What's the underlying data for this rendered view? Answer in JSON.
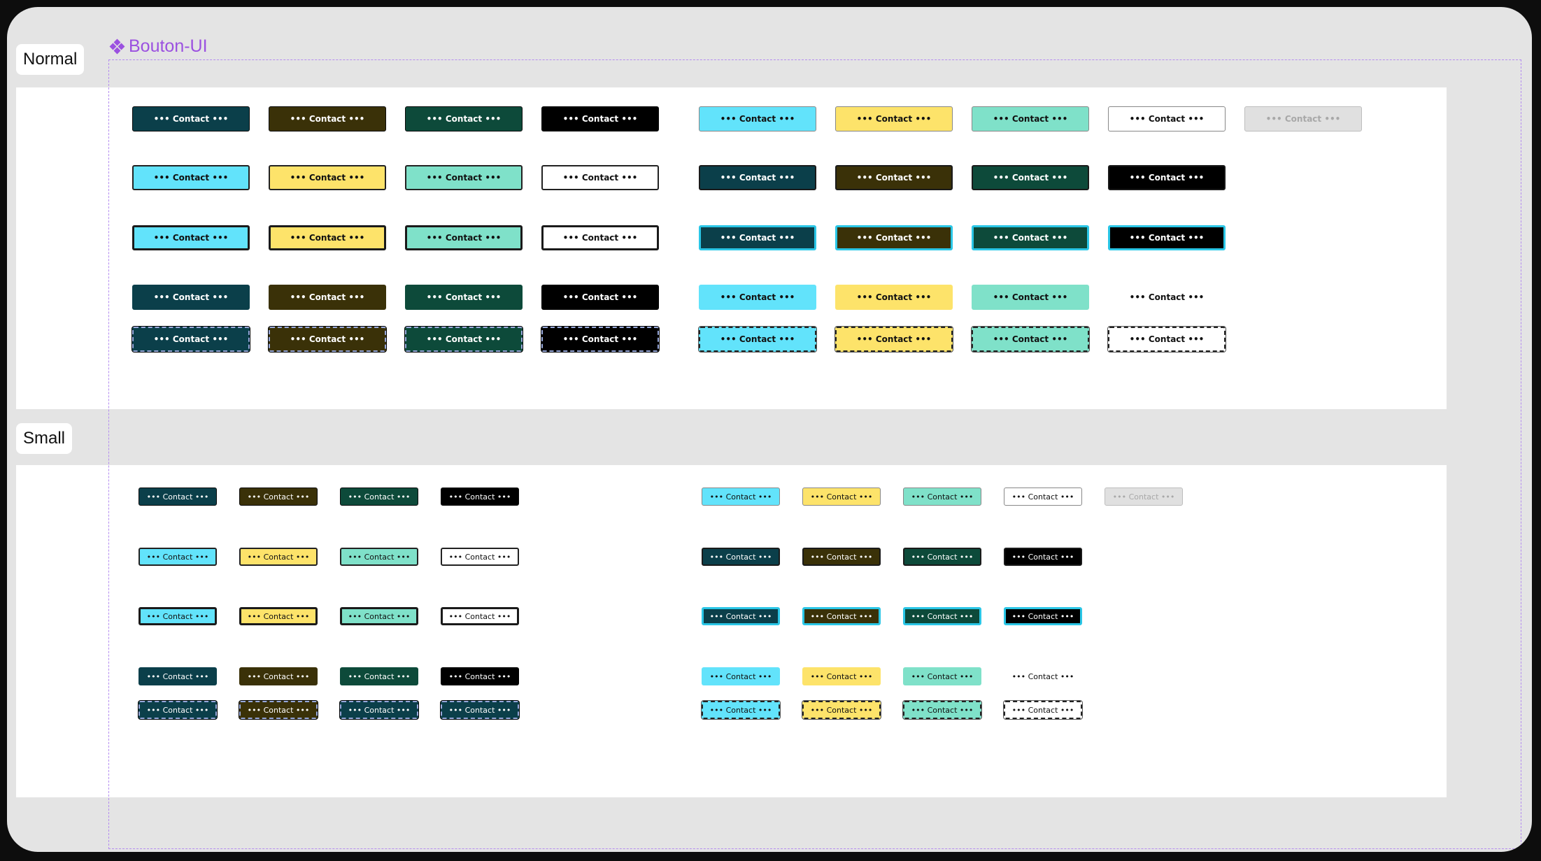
{
  "frame": {
    "name": "Bouton-UI"
  },
  "sections": {
    "normal": {
      "label": "Normal"
    },
    "small": {
      "label": "Small"
    }
  },
  "button_label": "••• Contact •••",
  "colors": {
    "teal_dark": "#0b3f4a",
    "olive_dark": "#3a3108",
    "green_dark": "#0d4a3a",
    "black": "#000000",
    "cyan": "#62e3fb",
    "yellow": "#fde36a",
    "mint": "#7fe1c9",
    "white": "#ffffff",
    "disabled": "#e0e0e0",
    "frame_accent": "#9b51e0"
  },
  "normal_rows": [
    [
      "teal_dark",
      "olive_dark",
      "green_dark",
      "black",
      "cyan",
      "yellow",
      "mint",
      "white",
      "disabled"
    ],
    [
      "cyan",
      "yellow",
      "mint",
      "white",
      "teal_dark",
      "olive_dark",
      "green_dark",
      "black"
    ],
    [
      "cyan",
      "yellow",
      "mint",
      "white",
      "teal_dark",
      "olive_dark",
      "green_dark",
      "black"
    ],
    [
      "teal_dark",
      "olive_dark",
      "green_dark",
      "black",
      "cyan",
      "yellow",
      "mint",
      "white"
    ],
    [
      "teal_dark",
      "olive_dark",
      "green_dark",
      "black",
      "cyan",
      "yellow",
      "mint",
      "white"
    ]
  ],
  "small_rows": [
    [
      "teal_dark",
      "olive_dark",
      "green_dark",
      "black",
      "cyan",
      "yellow",
      "mint",
      "white",
      "disabled"
    ],
    [
      "cyan",
      "yellow",
      "mint",
      "white",
      "teal_dark",
      "olive_dark",
      "green_dark",
      "black"
    ],
    [
      "cyan",
      "yellow",
      "mint",
      "white",
      "teal_dark",
      "olive_dark",
      "green_dark",
      "black"
    ],
    [
      "teal_dark",
      "olive_dark",
      "green_dark",
      "black",
      "cyan",
      "yellow",
      "mint",
      "white"
    ],
    [
      "teal_dark",
      "olive_dark",
      "teal_dark",
      "teal_dark",
      "cyan",
      "yellow",
      "mint",
      "white"
    ]
  ],
  "row_states": [
    "default",
    "outlined",
    "focused",
    "borderless",
    "dashed"
  ]
}
